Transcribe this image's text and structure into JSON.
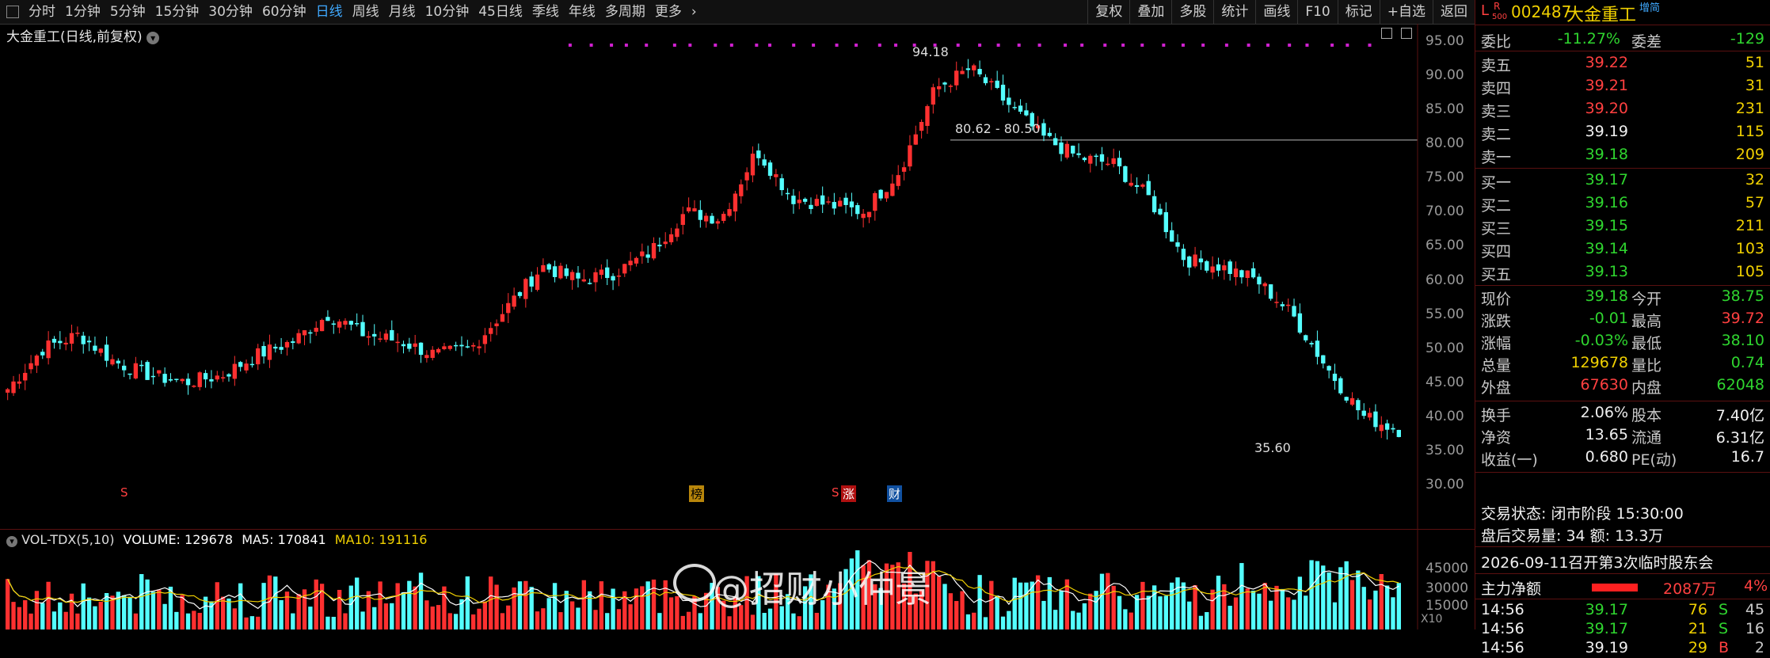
{
  "toolbar": {
    "periods": [
      "分时",
      "1分钟",
      "5分钟",
      "15分钟",
      "30分钟",
      "60分钟",
      "日线",
      "周线",
      "月线",
      "10分钟",
      "45日线",
      "季线",
      "年线",
      "多周期",
      "更多"
    ],
    "active": "日线",
    "right_tools": [
      "复权",
      "叠加",
      "多股",
      "统计",
      "画线",
      "F10",
      "标记",
      "+自选",
      "返回"
    ]
  },
  "chart": {
    "title": "大金重工(日线,前复权)",
    "y_ticks": [
      "95.00",
      "90.00",
      "85.00",
      "80.00",
      "75.00",
      "70.00",
      "65.00",
      "60.00",
      "55.00",
      "50.00",
      "45.00",
      "40.00",
      "35.00",
      "30.00"
    ],
    "high_label": "94.18",
    "low_label": "35.60",
    "range_label": "80.62 - 80.50",
    "markers": [
      "S",
      "榜",
      "S",
      "涨",
      "财"
    ]
  },
  "volume": {
    "title": "VOL-TDX(5,10)",
    "volume_label": "VOLUME: 129678",
    "ma5_label": "MA5: 170841",
    "ma10_label": "MA10: 191116",
    "y_ticks": [
      "45000",
      "30000",
      "15000"
    ],
    "unit": "X10"
  },
  "watermark": "@招财小仲景",
  "quote": {
    "code": "002487",
    "name": "大金重工",
    "badge_l": "L",
    "badge_r": "R",
    "badge_500": "500",
    "badge_tag": "增简",
    "weibi_label": "委比",
    "weibi": "-11.27%",
    "weicha_label": "委差",
    "weicha": "-129",
    "sells": [
      {
        "label": "卖五",
        "price": "39.22",
        "vol": "51"
      },
      {
        "label": "卖四",
        "price": "39.21",
        "vol": "31"
      },
      {
        "label": "卖三",
        "price": "39.20",
        "vol": "231"
      },
      {
        "label": "卖二",
        "price": "39.19",
        "vol": "115"
      },
      {
        "label": "卖一",
        "price": "39.18",
        "vol": "209"
      }
    ],
    "buys": [
      {
        "label": "买一",
        "price": "39.17",
        "vol": "32"
      },
      {
        "label": "买二",
        "price": "39.16",
        "vol": "57"
      },
      {
        "label": "买三",
        "price": "39.15",
        "vol": "211"
      },
      {
        "label": "买四",
        "price": "39.14",
        "vol": "103"
      },
      {
        "label": "买五",
        "price": "39.13",
        "vol": "105"
      }
    ],
    "stats": [
      {
        "l1": "现价",
        "v1": "39.18",
        "l2": "今开",
        "v2": "38.75"
      },
      {
        "l1": "涨跌",
        "v1": "-0.01",
        "l2": "最高",
        "v2": "39.72"
      },
      {
        "l1": "涨幅",
        "v1": "-0.03%",
        "l2": "最低",
        "v2": "38.10"
      },
      {
        "l1": "总量",
        "v1": "129678",
        "l2": "量比",
        "v2": "0.74"
      },
      {
        "l1": "外盘",
        "v1": "67630",
        "l2": "内盘",
        "v2": "62048"
      }
    ],
    "stats2": [
      {
        "l1": "换手",
        "v1": "2.06%",
        "l2": "股本",
        "v2": "7.40亿"
      },
      {
        "l1": "净资",
        "v1": "13.65",
        "l2": "流通",
        "v2": "6.31亿"
      },
      {
        "l1": "收益(一)",
        "v1": "0.680",
        "l2": "PE(动)",
        "v2": "16.7"
      }
    ],
    "trade_status": "交易状态: 闭市阶段 15:30:00",
    "after_hours": "盘后交易量: 34  额: 13.3万",
    "notice": "2026-09-11召开第3次临时股东会",
    "main_flow_label": "主力净额",
    "main_flow_value": "2087万",
    "main_flow_pct": "4%",
    "ticks": [
      {
        "time": "14:56",
        "price": "39.17",
        "vol": "76",
        "bs": "S",
        "n": "45"
      },
      {
        "time": "14:56",
        "price": "39.17",
        "vol": "21",
        "bs": "S",
        "n": "16"
      },
      {
        "time": "14:56",
        "price": "39.19",
        "vol": "29",
        "bs": "B",
        "n": "2"
      }
    ]
  },
  "colors": {
    "up": "#ff3030",
    "down": "#54ffff",
    "ma5": "#ffffff",
    "ma10": "#f0d000",
    "grid": "#5a1010"
  },
  "chart_data": {
    "type": "line",
    "x": [
      1,
      2,
      3,
      4,
      5,
      6,
      7,
      8,
      9,
      10,
      11,
      12,
      13,
      14,
      15,
      16,
      17,
      18,
      19,
      20,
      21,
      22,
      23,
      24,
      25,
      26,
      27,
      28,
      29,
      30,
      31,
      32,
      33,
      34,
      35,
      36,
      37,
      38,
      39,
      40
    ],
    "series": [
      {
        "values": [
          44,
          50,
          52,
          48,
          46,
          45,
          46,
          49,
          51,
          55,
          52,
          51,
          49,
          50,
          56,
          62,
          60,
          61,
          64,
          70,
          69,
          79,
          72,
          71,
          70,
          76,
          88,
          91,
          86,
          81,
          78,
          77,
          72,
          63,
          62,
          60,
          55,
          47,
          40,
          38
        ]
      }
    ],
    "ylim": [
      30,
      95
    ]
  }
}
